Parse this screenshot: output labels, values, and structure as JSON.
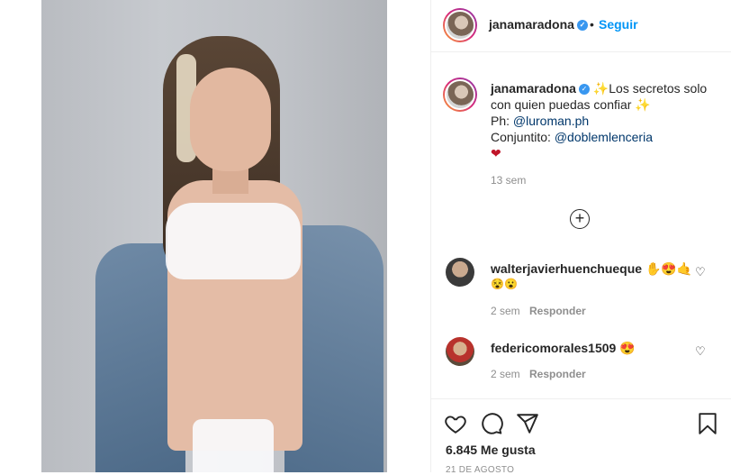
{
  "post": {
    "username": "janamaradona",
    "follow_label": "Seguir",
    "dot": "•"
  },
  "caption": {
    "username": "janamaradona",
    "text1": "Los secretos solo con quien puedas confiar",
    "ph_label": "Ph: ",
    "ph_link": "@luroman.ph",
    "set_label": "Conjuntito: ",
    "set_link": "@doblemlenceria",
    "heart": "❤",
    "time": "13 sem"
  },
  "comments": [
    {
      "username": "walterjavierhuenchueque",
      "emoji": "✋😍🤙",
      "emoji2": "😵😮",
      "time": "2 sem",
      "reply_label": "Responder"
    },
    {
      "username": "federicomorales1509",
      "emoji": "😍",
      "time": "2 sem",
      "reply_label": "Responder"
    }
  ],
  "footer": {
    "likes": "6.845 Me gusta",
    "date": "21 DE AGOSTO"
  },
  "icons": [
    "verified-icon",
    "sparkles-icon",
    "heart-icon",
    "add-circle-icon",
    "like-icon",
    "comment-icon",
    "share-icon",
    "bookmark-icon"
  ],
  "colors": {
    "accent": "#0095f6",
    "verified": "#3897f0",
    "link": "#00376b",
    "muted": "#8e8e8e"
  }
}
